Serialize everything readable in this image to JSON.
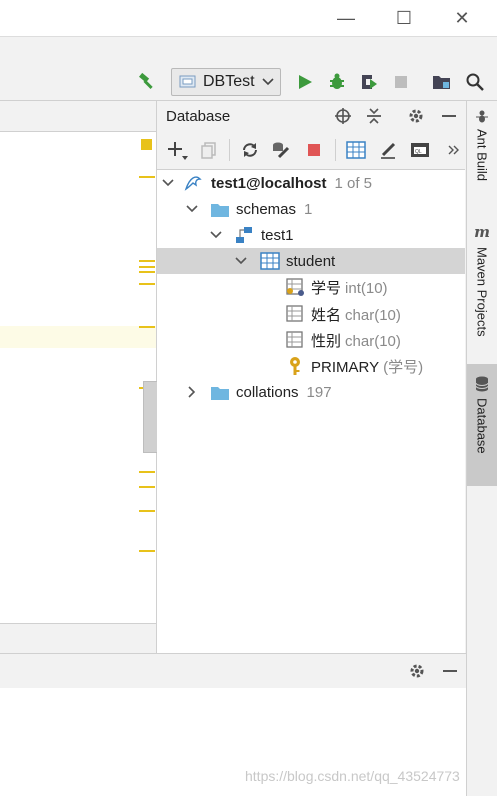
{
  "window": {
    "minimize_glyph": "—",
    "maximize_glyph": "☐",
    "close_glyph": "✕"
  },
  "toolbar": {
    "run_config_label": "DBTest"
  },
  "database_panel": {
    "title": "Database",
    "tree": {
      "connection": {
        "label": "test1@localhost",
        "meta": "1 of 5"
      },
      "schemas": {
        "label": "schemas",
        "meta": "1"
      },
      "schema": {
        "label": "test1"
      },
      "table": {
        "label": "student"
      },
      "columns": [
        {
          "name": "学号",
          "type": "int(10)"
        },
        {
          "name": "姓名",
          "type": "char(10)"
        },
        {
          "name": "性别",
          "type": "char(10)"
        }
      ],
      "key": {
        "name": "PRIMARY",
        "cols": "(学号)"
      },
      "collations": {
        "label": "collations",
        "meta": "197"
      }
    }
  },
  "right_tabs": [
    {
      "label": "Ant Build",
      "icon": "ant-icon"
    },
    {
      "label": "Maven Projects",
      "icon": "maven-icon"
    },
    {
      "label": "Database",
      "icon": "database-icon"
    }
  ],
  "maven_glyph": "m",
  "watermark": "https://blog.csdn.net/qq_43524773",
  "colors": {
    "accent_green": "#3d9a3d",
    "stop_red": "#e05555",
    "folder_blue": "#6fb6e0",
    "marker_yellow": "#e8c21a",
    "selection": "#d4d4d4"
  }
}
